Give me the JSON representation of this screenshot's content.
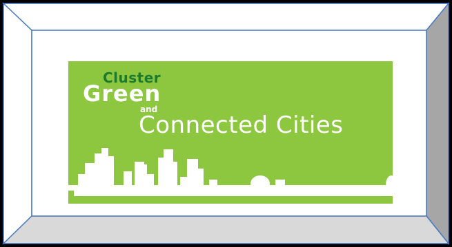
{
  "colors": {
    "background": "#000000",
    "frame_outer_face": "#ffffff",
    "frame_right_face": "#a6a6a6",
    "frame_bottom_face": "#d9d9d9",
    "frame_edge": "#4a7bbf",
    "inner_panel": "#ffffff",
    "logo_green": "#8dc63f",
    "cluster_green": "#1a7a2e",
    "logo_white": "#ffffff"
  },
  "logo": {
    "cluster": "Cluster",
    "green": "Green",
    "and": "and",
    "connected_cities": "Connected Cities"
  }
}
